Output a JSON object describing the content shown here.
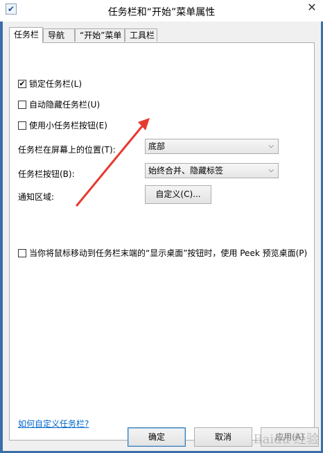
{
  "window": {
    "title": "任务栏和“开始”菜单属性",
    "close_glyph": "✕"
  },
  "tabs": [
    {
      "label": "任务栏",
      "active": true
    },
    {
      "label": "导航",
      "active": false
    },
    {
      "label": "“开始”菜单",
      "active": false
    },
    {
      "label": "工具栏",
      "active": false
    }
  ],
  "options": {
    "lock_taskbar": {
      "label": "锁定任务栏(L)",
      "checked": true
    },
    "auto_hide": {
      "label": "自动隐藏任务栏(U)",
      "checked": false
    },
    "small_buttons": {
      "label": "使用小任务栏按钮(E)",
      "checked": false
    }
  },
  "position": {
    "label": "任务栏在屏幕上的位置(T):",
    "value": "底部"
  },
  "buttons_setting": {
    "label": "任务栏按钮(B):",
    "value": "始终合并、隐藏标签"
  },
  "notification": {
    "label": "通知区域:",
    "button": "自定义(C)..."
  },
  "peek": {
    "label": "当你将鼠标移动到任务栏末端的“显示桌面”按钮时，使用 Peek 预览桌面(P)",
    "checked": false
  },
  "help_link": "如何自定义任务栏?",
  "footer": {
    "ok": "确定",
    "cancel": "取消",
    "apply": "应用(A)"
  },
  "watermark": "Baidu 经验",
  "colors": {
    "arrow": "#e8392f",
    "link": "#0066cc",
    "frame": "#3b6da7"
  }
}
